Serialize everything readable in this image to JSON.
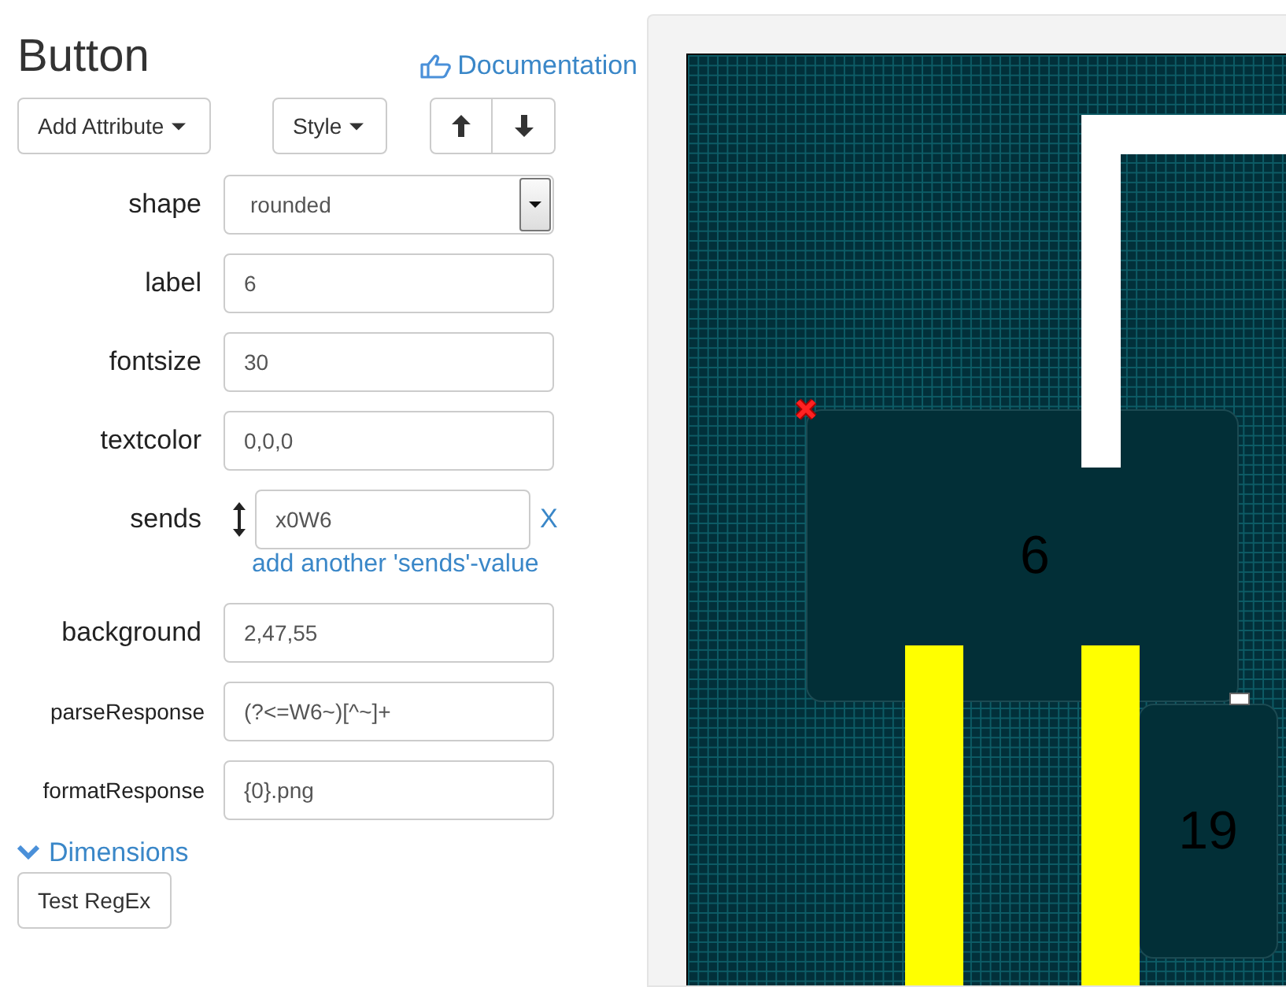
{
  "title": "Button",
  "doc_link": "Documentation",
  "toolbar": [
    {
      "label": "Add Attribute",
      "kind": "dropdown"
    },
    {
      "label": "Style",
      "kind": "dropdown"
    },
    {
      "kind": "arrows"
    }
  ],
  "fields": [
    {
      "label": "shape",
      "value": "rounded",
      "kind": "select"
    },
    {
      "label": "label",
      "value": "6",
      "kind": "text"
    },
    {
      "label": "fontsize",
      "value": "30",
      "kind": "text"
    },
    {
      "label": "textcolor",
      "value": "0,0,0",
      "kind": "text"
    },
    {
      "label": "sends",
      "value": "x0W6",
      "kind": "list",
      "remove": "X",
      "add_link": "add another 'sends'-value"
    },
    {
      "label": "background",
      "value": "2,47,55",
      "kind": "text"
    },
    {
      "label": "parseResponse",
      "value": "(?<=W6~)[^~]+",
      "kind": "compact"
    },
    {
      "label": "formatResponse",
      "value": "{0}.png",
      "kind": "compact"
    }
  ],
  "section": {
    "label": "Dimensions"
  },
  "test_button": "Test RegEx",
  "canvas_buttons": [
    {
      "label": "6",
      "selected": true
    },
    {
      "label": "19",
      "selected": false
    }
  ]
}
